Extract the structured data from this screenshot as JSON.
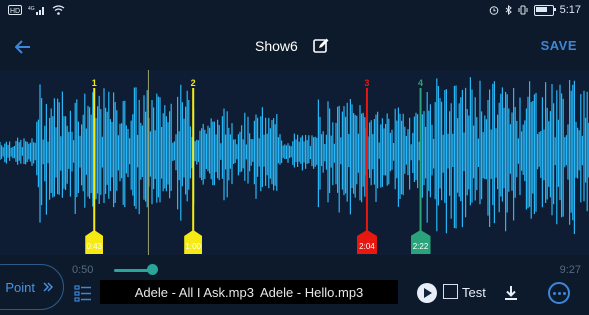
{
  "status_bar": {
    "left_icons": [
      "hd-icon",
      "signal-4g-icon",
      "wifi-icon"
    ],
    "right_icons": [
      "alarm-icon",
      "bluetooth-icon",
      "vibrate-icon",
      "battery-icon"
    ],
    "time": "5:17"
  },
  "header": {
    "title": "Show6",
    "save_label": "SAVE",
    "back_icon": "back-arrow-icon",
    "edit_icon": "edit-icon"
  },
  "waveform": {
    "color": "#29b6f6",
    "markers": [
      {
        "label": "1",
        "color": "#f5ea14",
        "time": "0:43",
        "position": 0.16
      },
      {
        "label": "2",
        "color": "#f5ea14",
        "time": "1:00",
        "position": 0.328
      },
      {
        "label": "3",
        "color": "#e8170f",
        "time": "2:04",
        "position": 0.623
      },
      {
        "label": "4",
        "color": "#2aa37a",
        "time": "2:22",
        "position": 0.714
      }
    ],
    "playhead_position": 0.252
  },
  "playback": {
    "current_time": "0:50",
    "total_time": "9:27",
    "progress": 0.088
  },
  "controls": {
    "point_label": "Point",
    "tracks": [
      "Adele - All I Ask.mp3",
      "Adele - Hello.mp3"
    ],
    "test_label": "Test",
    "test_checked": false
  }
}
